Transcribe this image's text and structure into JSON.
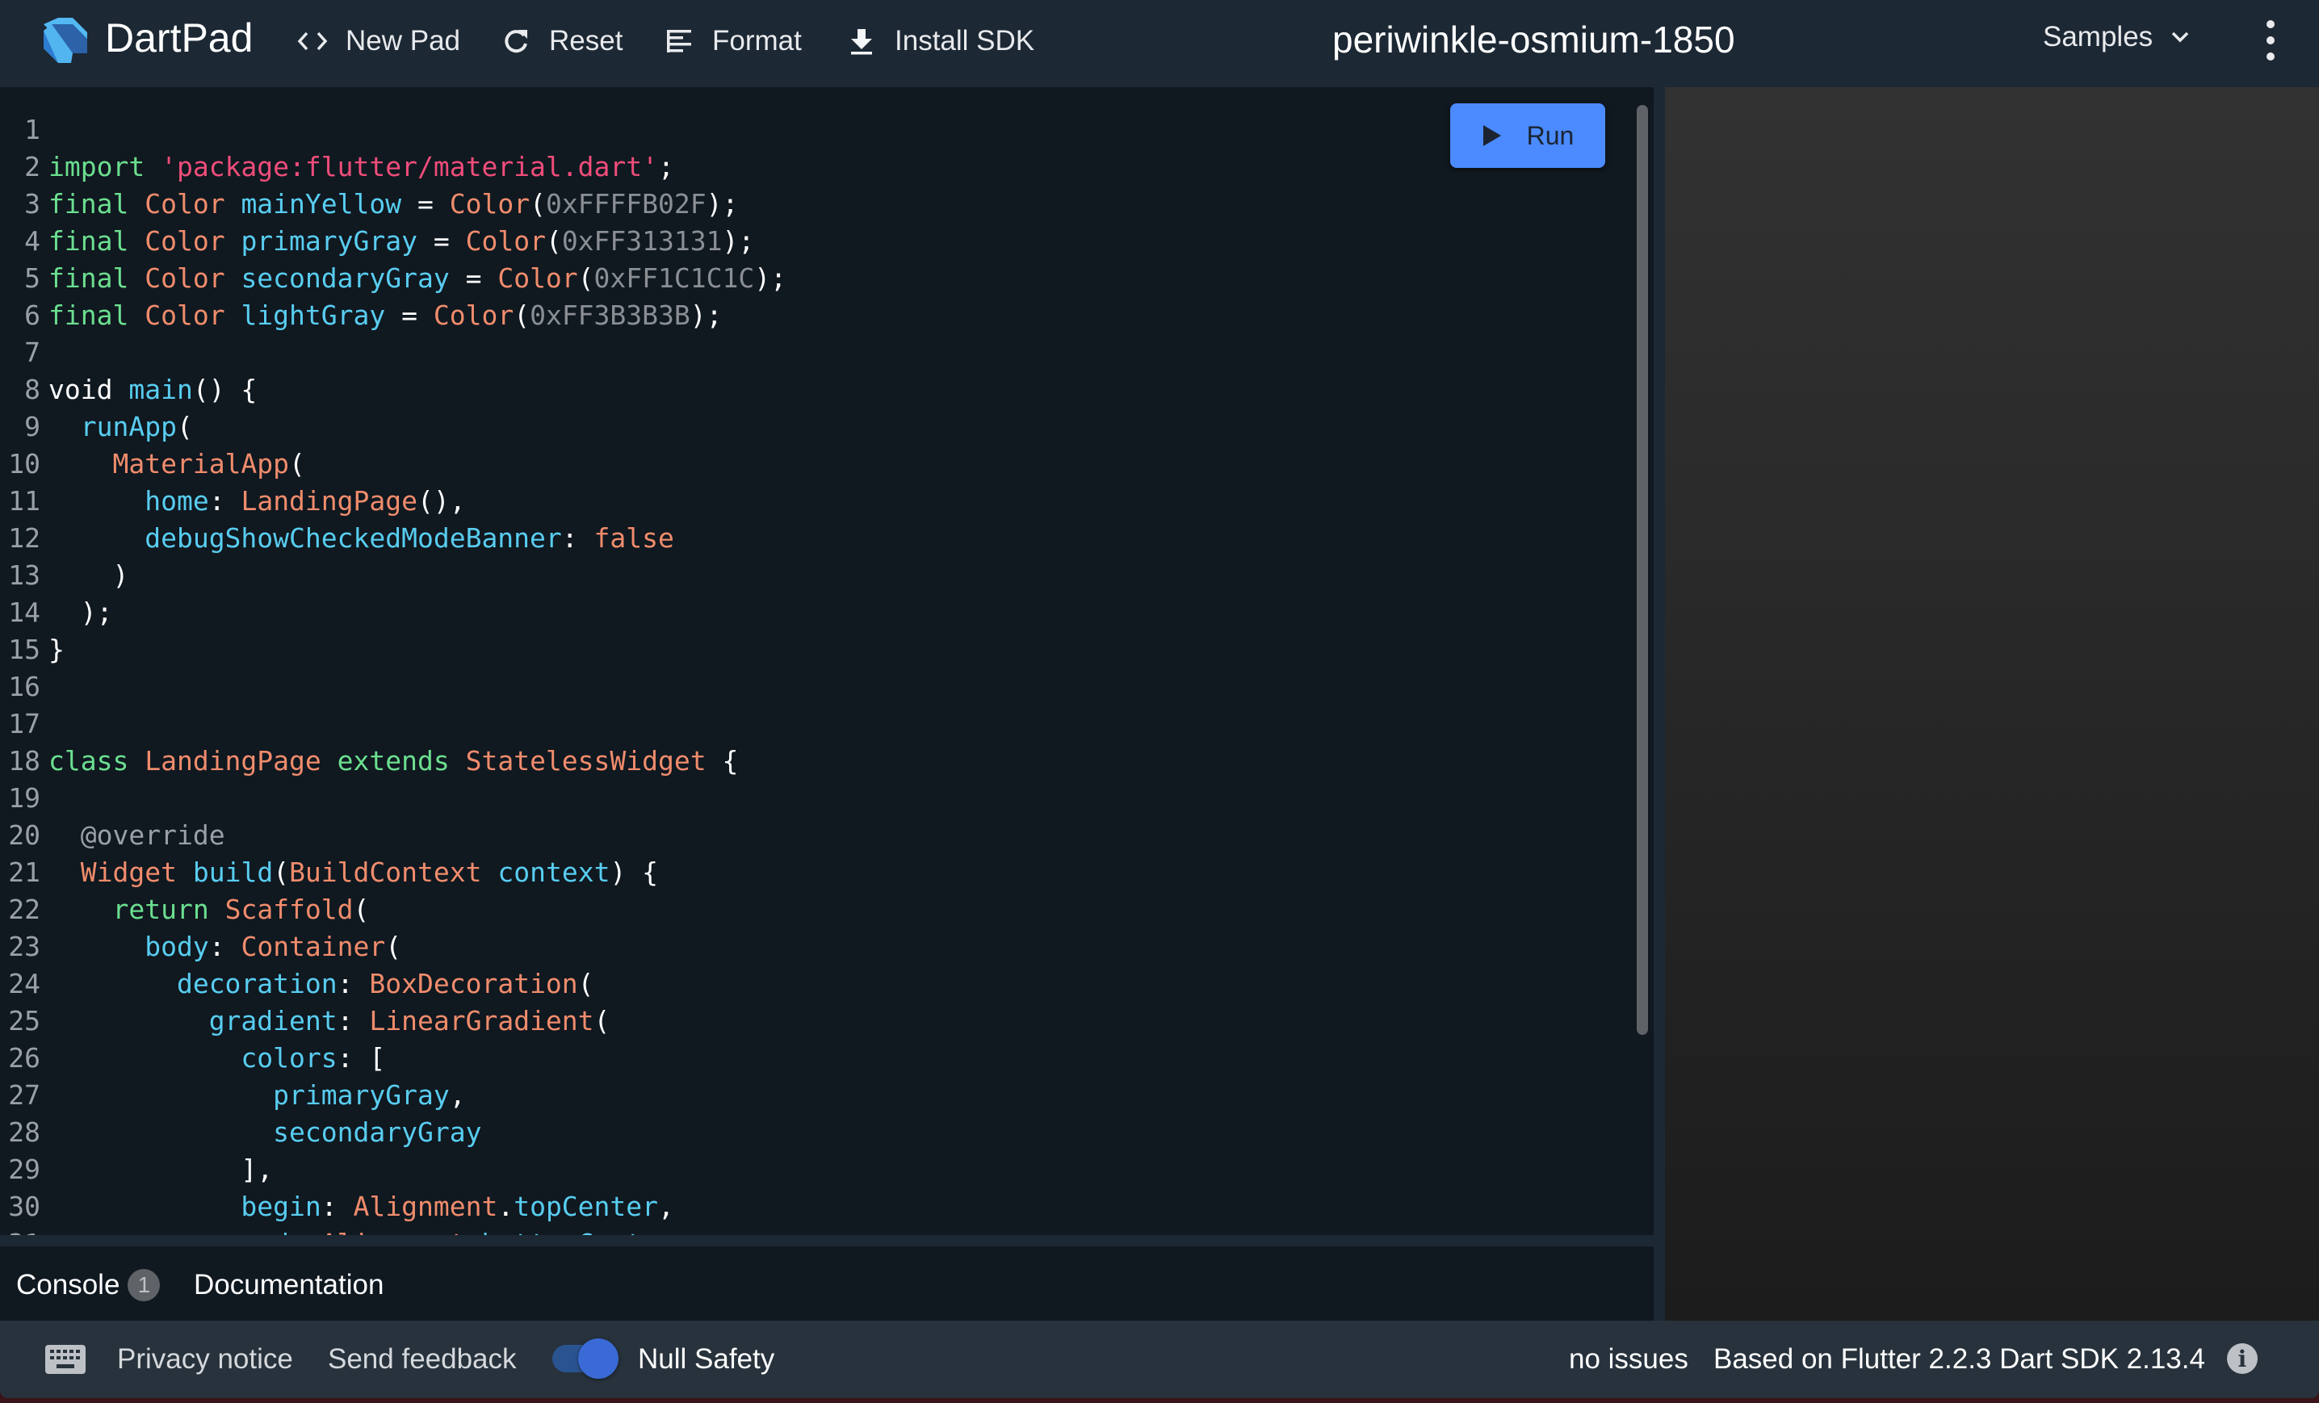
{
  "header": {
    "brand": "DartPad",
    "new_pad": "New Pad",
    "reset": "Reset",
    "format": "Format",
    "install_sdk": "Install SDK",
    "pad_title": "periwinkle-osmium-1850",
    "samples": "Samples"
  },
  "editor": {
    "run_label": "Run",
    "lines": [
      [],
      [
        [
          "kw",
          "import"
        ],
        [
          "pl",
          " "
        ],
        [
          "st",
          "'package:flutter/material.dart'"
        ],
        [
          "pl",
          ";"
        ]
      ],
      [
        [
          "kw",
          "final"
        ],
        [
          "pl",
          " "
        ],
        [
          "ty",
          "Color"
        ],
        [
          "pl",
          " "
        ],
        [
          "id",
          "mainYellow"
        ],
        [
          "pl",
          " = "
        ],
        [
          "ty",
          "Color"
        ],
        [
          "pl",
          "("
        ],
        [
          "nm",
          "0xFFFFB02F"
        ],
        [
          "pl",
          ");"
        ]
      ],
      [
        [
          "kw",
          "final"
        ],
        [
          "pl",
          " "
        ],
        [
          "ty",
          "Color"
        ],
        [
          "pl",
          " "
        ],
        [
          "id",
          "primaryGray"
        ],
        [
          "pl",
          " = "
        ],
        [
          "ty",
          "Color"
        ],
        [
          "pl",
          "("
        ],
        [
          "nm",
          "0xFF313131"
        ],
        [
          "pl",
          ");"
        ]
      ],
      [
        [
          "kw",
          "final"
        ],
        [
          "pl",
          " "
        ],
        [
          "ty",
          "Color"
        ],
        [
          "pl",
          " "
        ],
        [
          "id",
          "secondaryGray"
        ],
        [
          "pl",
          " = "
        ],
        [
          "ty",
          "Color"
        ],
        [
          "pl",
          "("
        ],
        [
          "nm",
          "0xFF1C1C1C"
        ],
        [
          "pl",
          ");"
        ]
      ],
      [
        [
          "kw",
          "final"
        ],
        [
          "pl",
          " "
        ],
        [
          "ty",
          "Color"
        ],
        [
          "pl",
          " "
        ],
        [
          "id",
          "lightGray"
        ],
        [
          "pl",
          " = "
        ],
        [
          "ty",
          "Color"
        ],
        [
          "pl",
          "("
        ],
        [
          "nm",
          "0xFF3B3B3B"
        ],
        [
          "pl",
          ");"
        ]
      ],
      [],
      [
        [
          "pl",
          "void "
        ],
        [
          "id",
          "main"
        ],
        [
          "pl",
          "() {"
        ]
      ],
      [
        [
          "pl",
          "  "
        ],
        [
          "id",
          "runApp"
        ],
        [
          "pl",
          "("
        ]
      ],
      [
        [
          "pl",
          "    "
        ],
        [
          "ty",
          "MaterialApp"
        ],
        [
          "pl",
          "("
        ]
      ],
      [
        [
          "pl",
          "      "
        ],
        [
          "id",
          "home"
        ],
        [
          "pl",
          ": "
        ],
        [
          "ty",
          "LandingPage"
        ],
        [
          "pl",
          "(),"
        ]
      ],
      [
        [
          "pl",
          "      "
        ],
        [
          "id",
          "debugShowCheckedModeBanner"
        ],
        [
          "pl",
          ": "
        ],
        [
          "ty",
          "false"
        ]
      ],
      [
        [
          "pl",
          "    )"
        ]
      ],
      [
        [
          "pl",
          "  );"
        ]
      ],
      [
        [
          "pl",
          "}"
        ]
      ],
      [],
      [],
      [
        [
          "kw",
          "class"
        ],
        [
          "pl",
          " "
        ],
        [
          "ty",
          "LandingPage"
        ],
        [
          "pl",
          " "
        ],
        [
          "kw",
          "extends"
        ],
        [
          "pl",
          " "
        ],
        [
          "ty",
          "StatelessWidget"
        ],
        [
          "pl",
          " {"
        ]
      ],
      [],
      [
        [
          "pl",
          "  "
        ],
        [
          "an",
          "@override"
        ]
      ],
      [
        [
          "pl",
          "  "
        ],
        [
          "ty",
          "Widget"
        ],
        [
          "pl",
          " "
        ],
        [
          "id",
          "build"
        ],
        [
          "pl",
          "("
        ],
        [
          "ty",
          "BuildContext"
        ],
        [
          "pl",
          " "
        ],
        [
          "id",
          "context"
        ],
        [
          "pl",
          ") {"
        ]
      ],
      [
        [
          "pl",
          "    "
        ],
        [
          "kw",
          "return"
        ],
        [
          "pl",
          " "
        ],
        [
          "ty",
          "Scaffold"
        ],
        [
          "pl",
          "("
        ]
      ],
      [
        [
          "pl",
          "      "
        ],
        [
          "id",
          "body"
        ],
        [
          "pl",
          ": "
        ],
        [
          "ty",
          "Container"
        ],
        [
          "pl",
          "("
        ]
      ],
      [
        [
          "pl",
          "        "
        ],
        [
          "id",
          "decoration"
        ],
        [
          "pl",
          ": "
        ],
        [
          "ty",
          "BoxDecoration"
        ],
        [
          "pl",
          "("
        ]
      ],
      [
        [
          "pl",
          "          "
        ],
        [
          "id",
          "gradient"
        ],
        [
          "pl",
          ": "
        ],
        [
          "ty",
          "LinearGradient"
        ],
        [
          "pl",
          "("
        ]
      ],
      [
        [
          "pl",
          "            "
        ],
        [
          "id",
          "colors"
        ],
        [
          "pl",
          ": ["
        ]
      ],
      [
        [
          "pl",
          "              "
        ],
        [
          "id",
          "primaryGray"
        ],
        [
          "pl",
          ","
        ]
      ],
      [
        [
          "pl",
          "              "
        ],
        [
          "id",
          "secondaryGray"
        ]
      ],
      [
        [
          "pl",
          "            ],"
        ]
      ],
      [
        [
          "pl",
          "            "
        ],
        [
          "id",
          "begin"
        ],
        [
          "pl",
          ": "
        ],
        [
          "ty",
          "Alignment"
        ],
        [
          "pl",
          "."
        ],
        [
          "id",
          "topCenter"
        ],
        [
          "pl",
          ","
        ]
      ],
      [
        [
          "pl",
          "            "
        ],
        [
          "id",
          "end"
        ],
        [
          "pl",
          ": "
        ],
        [
          "ty",
          "Alignment"
        ],
        [
          "pl",
          "."
        ],
        [
          "id",
          "bottomCenter"
        ]
      ]
    ]
  },
  "console": {
    "console_tab": "Console",
    "console_count": "1",
    "documentation_tab": "Documentation"
  },
  "footer": {
    "privacy": "Privacy notice",
    "feedback": "Send feedback",
    "null_safety": "Null Safety",
    "null_safety_enabled": true,
    "issues": "no issues",
    "version": "Based on Flutter 2.2.3 Dart SDK 2.13.4"
  },
  "icons": {
    "logo": "dart-logo",
    "new_pad": "code-brackets-icon",
    "reset": "refresh-icon",
    "format": "align-left-icon",
    "install": "download-icon",
    "samples": "chevron-down-icon",
    "menu": "more-vert-icon",
    "run": "play-icon",
    "keyboard": "keyboard-icon",
    "info": "info-icon"
  },
  "colors": {
    "accent": "#4b8bff",
    "header_bg": "#1c2834",
    "editor_bg": "#101820",
    "footer_bg": "#27323c"
  }
}
